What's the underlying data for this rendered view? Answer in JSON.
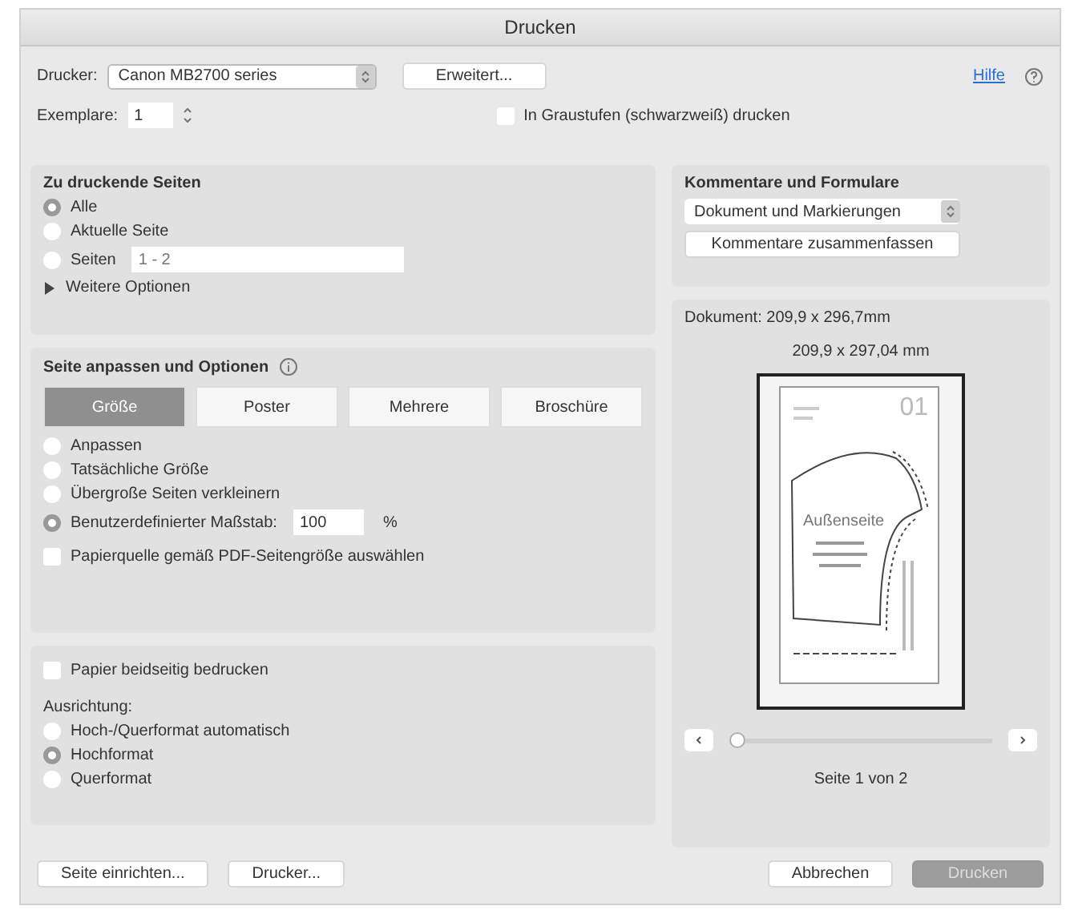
{
  "window": {
    "title": "Drucken"
  },
  "printer": {
    "label": "Drucker:",
    "value": "Canon MB2700 series"
  },
  "advanced_button": "Erweitert...",
  "help_link": "Hilfe",
  "copies": {
    "label": "Exemplare:",
    "value": "1"
  },
  "grayscale": {
    "label": "In Graustufen (schwarzweiß) drucken",
    "checked": false
  },
  "pages": {
    "title": "Zu druckende Seiten",
    "options": [
      {
        "label": "Alle",
        "selected": true,
        "kind": "plain"
      },
      {
        "label": "Aktuelle Seite",
        "selected": false,
        "kind": "plain"
      },
      {
        "label": "Seiten",
        "selected": false,
        "kind": "range",
        "placeholder": "1 - 2"
      }
    ],
    "more_options": {
      "label": "Weitere Optionen",
      "expanded": false
    }
  },
  "fit": {
    "title": "Seite anpassen und Optionen",
    "tabs": [
      {
        "label": "Größe",
        "selected": true
      },
      {
        "label": "Poster",
        "selected": false
      },
      {
        "label": "Mehrere",
        "selected": false
      },
      {
        "label": "Broschüre",
        "selected": false
      }
    ],
    "options": [
      {
        "label": "Anpassen",
        "selected": false,
        "kind": "plain"
      },
      {
        "label": "Tatsächliche Größe",
        "selected": false,
        "kind": "plain"
      },
      {
        "label": "Übergroße Seiten verkleinern",
        "selected": false,
        "kind": "plain"
      },
      {
        "label": "Benutzerdefinierter Maßstab:",
        "selected": true,
        "kind": "scale",
        "value": "100",
        "unit": "%"
      }
    ],
    "paper_source": {
      "label": "Papierquelle gemäß PDF-Seitengröße auswählen",
      "checked": false
    }
  },
  "duplex": {
    "label": "Papier beidseitig bedrucken",
    "checked": false
  },
  "orientation": {
    "label": "Ausrichtung:",
    "options": [
      {
        "label": "Hoch-/Querformat automatisch",
        "selected": false
      },
      {
        "label": "Hochformat",
        "selected": true
      },
      {
        "label": "Querformat",
        "selected": false
      }
    ]
  },
  "comments": {
    "title": "Kommentare und Formulare",
    "value": "Dokument und Markierungen",
    "button": "Kommentare zusammenfassen"
  },
  "preview": {
    "document_size": "Dokument: 209,9 x 296,7mm",
    "page_size": "209,9 x 297,04 mm",
    "page_number": "01",
    "page_heading": "Außenseite",
    "slider": {
      "level": 0
    },
    "page_label": "Seite 1 von 2"
  },
  "footer": {
    "left_buttons": [
      "Seite einrichten...",
      "Drucker..."
    ],
    "cancel": "Abbrechen",
    "print": {
      "label": "Drucken",
      "default": true
    }
  }
}
